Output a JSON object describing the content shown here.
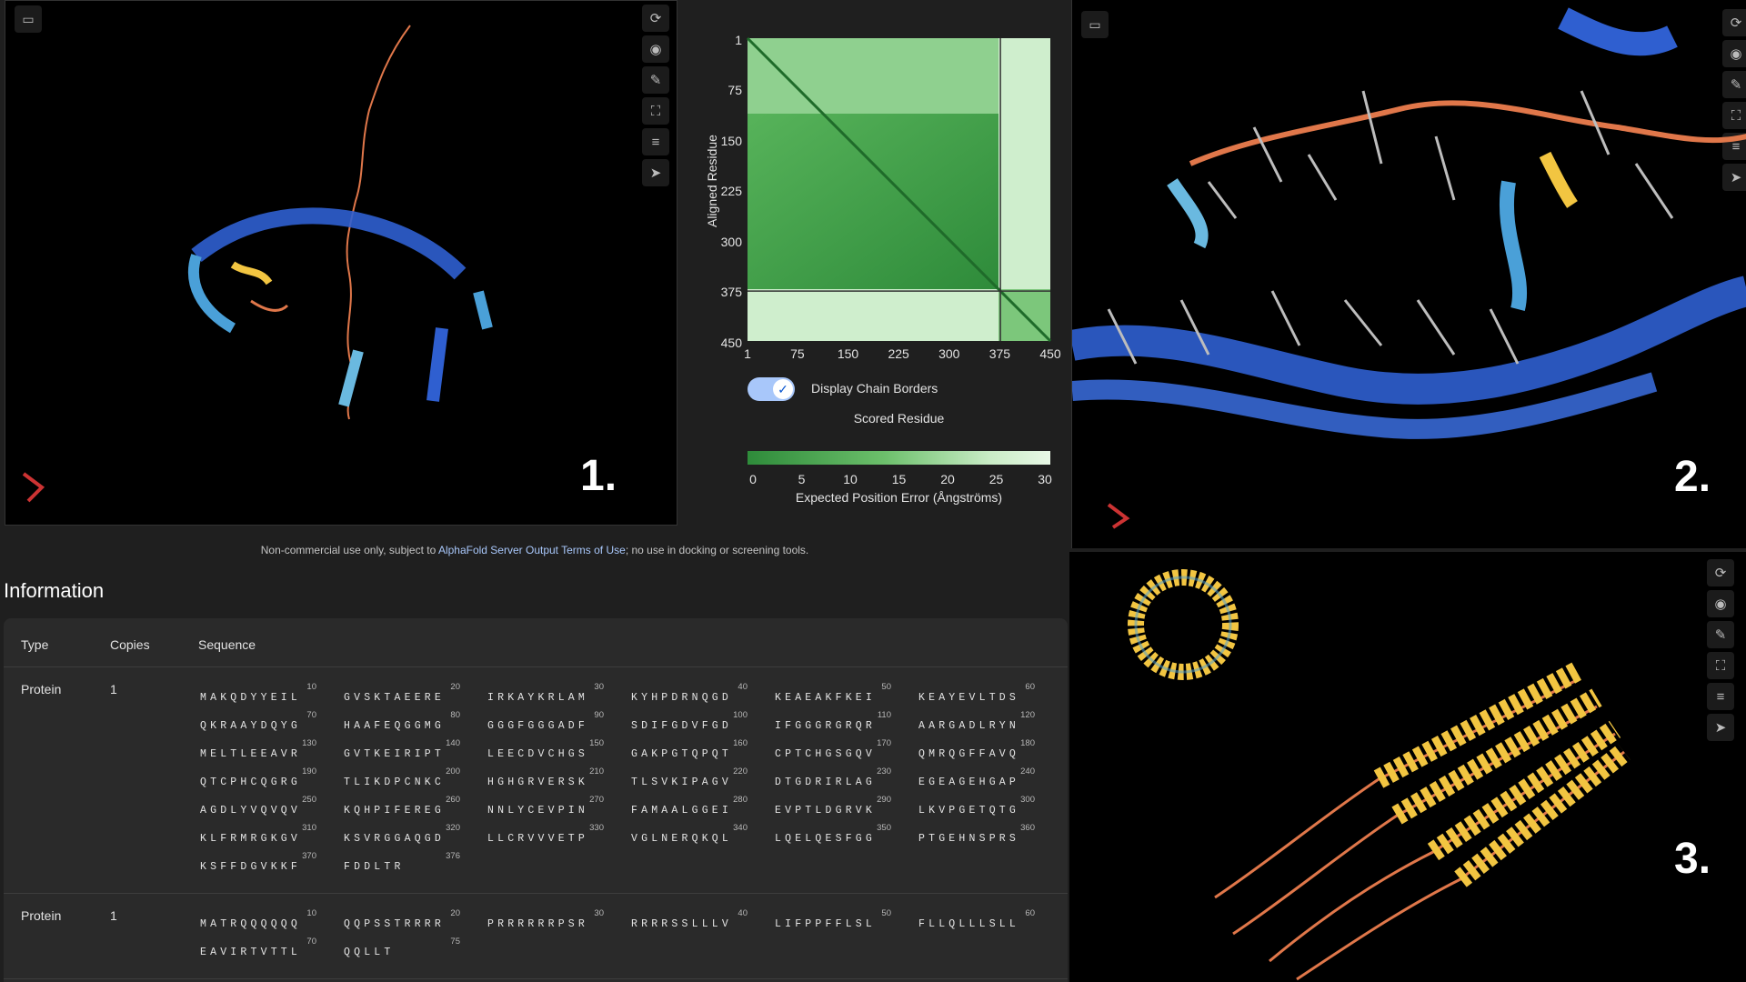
{
  "panel_labels": {
    "p1": "1.",
    "p2": "2.",
    "p3": "3."
  },
  "viewer_controls": [
    "save-icon",
    "refresh-icon",
    "target-icon",
    "wrench-icon",
    "fullscreen-icon",
    "sliders-icon",
    "cursor-icon"
  ],
  "pae": {
    "y_axis_label": "Aligned Residue",
    "y_ticks": [
      "1",
      "75",
      "150",
      "225",
      "300",
      "375",
      "450"
    ],
    "x_ticks": [
      "1",
      "75",
      "150",
      "225",
      "300",
      "375",
      "450"
    ],
    "toggle_label": "Display Chain Borders",
    "toggle_on": true,
    "x_axis_label": "Scored Residue",
    "legend_ticks": [
      "0",
      "5",
      "10",
      "15",
      "20",
      "25",
      "30"
    ],
    "legend_label": "Expected Position Error (Ångströms)",
    "colors": {
      "low": "#2e8b3a",
      "high": "#e8f8e6"
    },
    "chain_border": 376
  },
  "notice": {
    "prefix": "Non-commercial use only, subject to ",
    "link": "AlphaFold Server Output Terms of Use",
    "suffix": "; no use in docking or screening tools."
  },
  "info": {
    "title": "Information",
    "headers": {
      "type": "Type",
      "copies": "Copies",
      "sequence": "Sequence"
    },
    "entities": [
      {
        "type": "Protein",
        "copies": "1",
        "rows": [
          [
            {
              "n": "10",
              "s": "MAKQDYYEIL"
            },
            {
              "n": "20",
              "s": "GVSKTAEERE"
            },
            {
              "n": "30",
              "s": "IRKAYKRLAM"
            },
            {
              "n": "40",
              "s": "KYHPDRNQGD"
            },
            {
              "n": "50",
              "s": "KEAEAKFKEI"
            },
            {
              "n": "60",
              "s": "KEAYEVLTDS"
            }
          ],
          [
            {
              "n": "70",
              "s": "QKRAAYDQYG"
            },
            {
              "n": "80",
              "s": "HAAFEQGGMG"
            },
            {
              "n": "90",
              "s": "GGGFGGGADF"
            },
            {
              "n": "100",
              "s": "SDIFGDVFGD"
            },
            {
              "n": "110",
              "s": "IFGGGRGRQR"
            },
            {
              "n": "120",
              "s": "AARGADLRYN"
            }
          ],
          [
            {
              "n": "130",
              "s": "MELTLEEAVR"
            },
            {
              "n": "140",
              "s": "GVTKEIRIPT"
            },
            {
              "n": "150",
              "s": "LEECDVCHGS"
            },
            {
              "n": "160",
              "s": "GAKPGTQPQT"
            },
            {
              "n": "170",
              "s": "CPTCHGSGQV"
            },
            {
              "n": "180",
              "s": "QMRQGFFAVQ"
            }
          ],
          [
            {
              "n": "190",
              "s": "QTCPHCQGRG"
            },
            {
              "n": "200",
              "s": "TLIKDPCNKC"
            },
            {
              "n": "210",
              "s": "HGHGRVERSK"
            },
            {
              "n": "220",
              "s": "TLSVKIPAGV"
            },
            {
              "n": "230",
              "s": "DTGDRIRLAG"
            },
            {
              "n": "240",
              "s": "EGEAGEHGAP"
            }
          ],
          [
            {
              "n": "250",
              "s": "AGDLYVQVQV"
            },
            {
              "n": "260",
              "s": "KQHPIFEREG"
            },
            {
              "n": "270",
              "s": "NNLYCEVPIN"
            },
            {
              "n": "280",
              "s": "FAMAALGGEI"
            },
            {
              "n": "290",
              "s": "EVPTLDGRVK"
            },
            {
              "n": "300",
              "s": "LKVPGETQTG"
            }
          ],
          [
            {
              "n": "310",
              "s": "KLFRMRGKGV"
            },
            {
              "n": "320",
              "s": "KSVRGGAQGD"
            },
            {
              "n": "330",
              "s": "LLCRVVVETP"
            },
            {
              "n": "340",
              "s": "VGLNERQKQL"
            },
            {
              "n": "350",
              "s": "LQELQESFGG"
            },
            {
              "n": "360",
              "s": "PTGEHNSPRS"
            }
          ],
          [
            {
              "n": "370",
              "s": "KSFFDGVKKF"
            },
            {
              "n": "376",
              "s": "FDDLTR"
            }
          ]
        ]
      },
      {
        "type": "Protein",
        "copies": "1",
        "rows": [
          [
            {
              "n": "10",
              "s": "MATRQQQQQQ"
            },
            {
              "n": "20",
              "s": "QQPSSTRRRR"
            },
            {
              "n": "30",
              "s": "PRRRRRRPSR"
            },
            {
              "n": "40",
              "s": "RRRRSSLLLV"
            },
            {
              "n": "50",
              "s": "LIFPPFFLSL"
            },
            {
              "n": "60",
              "s": "FLLQLLLSLL"
            }
          ],
          [
            {
              "n": "70",
              "s": "EAVIRTVTTL"
            },
            {
              "n": "75",
              "s": "QQLLT"
            }
          ]
        ]
      }
    ]
  }
}
